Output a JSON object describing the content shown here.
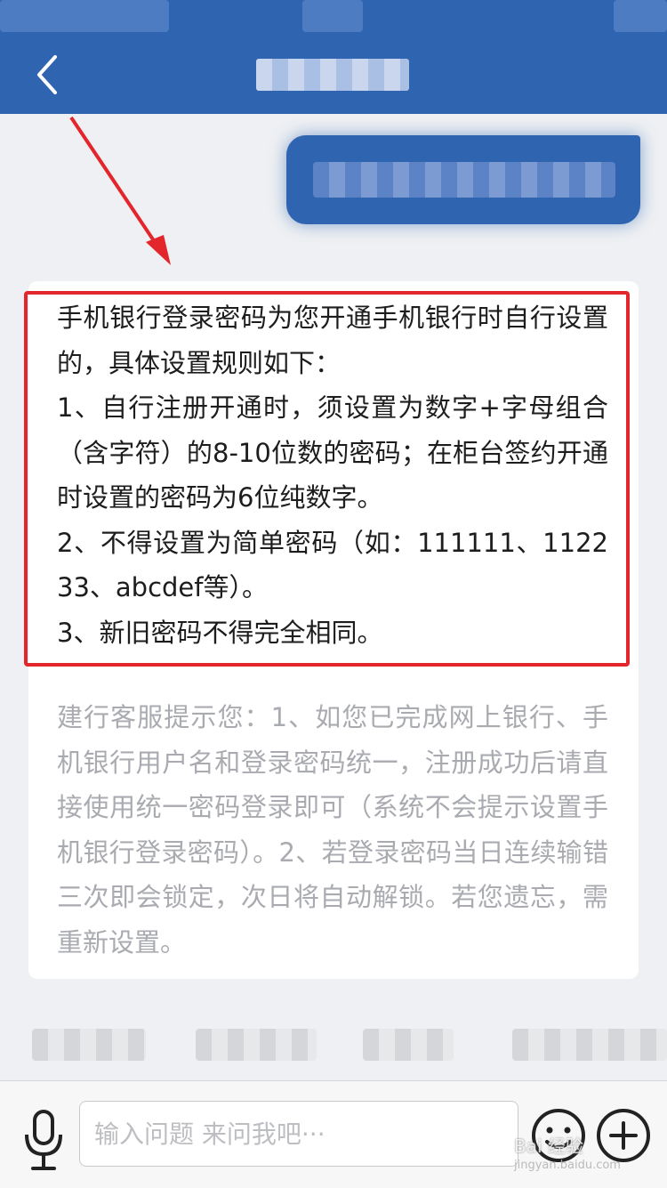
{
  "answer": {
    "lines": [
      "手机银行登录密码为您开通手机银行时自行设置的，具体设置规则如下：",
      "1、自行注册开通时，须设置为数字+字母组合（含字符）的8-10位数的密码；在柜台签约开通时设置的密码为6位纯数字。",
      "2、不得设置为简单密码（如：111111、112233、abcdef等）。",
      "3、新旧密码不得完全相同。"
    ]
  },
  "hint": {
    "text": "建行客服提示您：1、如您已完成网上银行、手机银行用户名和登录密码统一，注册成功后请直接使用统一密码登录即可（系统不会提示设置手机银行登录密码）。2、若登录密码当日连续输错三次即会锁定，次日将自动解锁。若您遗忘，需重新设置。"
  },
  "input": {
    "placeholder": "输入问题 来问我吧···"
  },
  "icons": {
    "back": "chevron-left-icon",
    "mic": "microphone-icon",
    "emoji": "smiley-face-icon",
    "plus": "plus-circle-icon"
  },
  "colors": {
    "header": "#2f65b0",
    "highlight": "#e3262b",
    "hint_text": "#a9abb0"
  },
  "watermark": {
    "main": "Bai 经验",
    "sub": "jingyan.baidu.com"
  }
}
